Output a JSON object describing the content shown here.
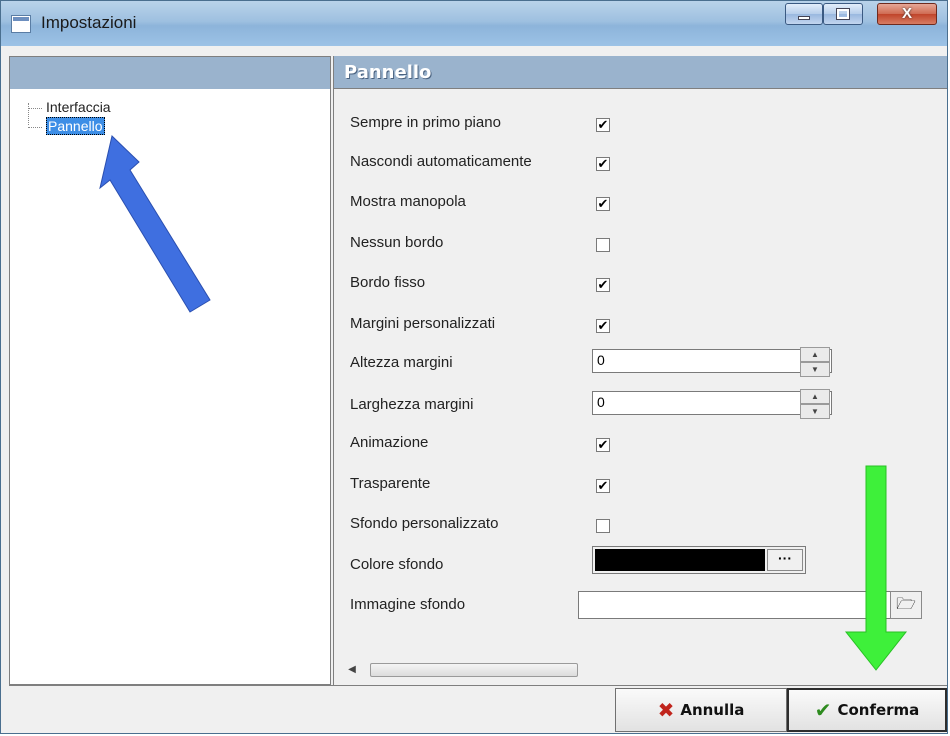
{
  "window": {
    "title": "Impostazioni",
    "controls": {
      "minimize_icon": "minimize-icon",
      "maximize_icon": "maximize-icon",
      "close_glyph": "X"
    }
  },
  "tree": {
    "items": [
      {
        "label": "Interfaccia",
        "selected": false
      },
      {
        "label": "Pannello",
        "selected": true
      }
    ]
  },
  "panel": {
    "header": "Pannello",
    "options": [
      {
        "label": "Sempre in primo piano",
        "type": "checkbox",
        "checked": true
      },
      {
        "label": "Nascondi automaticamente",
        "type": "checkbox",
        "checked": true
      },
      {
        "label": "Mostra manopola",
        "type": "checkbox",
        "checked": true
      },
      {
        "label": "Nessun bordo",
        "type": "checkbox",
        "checked": false
      },
      {
        "label": "Bordo fisso",
        "type": "checkbox",
        "checked": true
      },
      {
        "label": "Margini personalizzati",
        "type": "checkbox",
        "checked": true
      },
      {
        "label": "Altezza margini",
        "type": "spin",
        "value": "0"
      },
      {
        "label": "Larghezza margini",
        "type": "spin",
        "value": "0"
      },
      {
        "label": "Animazione",
        "type": "checkbox",
        "checked": true
      },
      {
        "label": "Trasparente",
        "type": "checkbox",
        "checked": true
      },
      {
        "label": "Sfondo personalizzato",
        "type": "checkbox",
        "checked": false
      },
      {
        "label": "Colore sfondo",
        "type": "color",
        "value": "#000000",
        "button": "···"
      },
      {
        "label": "Immagine sfondo",
        "type": "file",
        "value": ""
      }
    ]
  },
  "footer": {
    "cancel_label": "Annulla",
    "confirm_label": "Conferma"
  },
  "colors": {
    "header_bg": "#9ab3cd",
    "selection": "#3d8ee6",
    "annotation_blue": "#3f6fe0",
    "annotation_green": "#3ef03a"
  }
}
